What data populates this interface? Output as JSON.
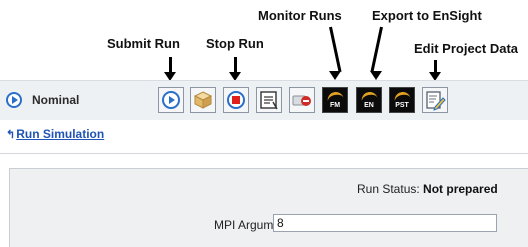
{
  "annotations": {
    "submit_run": "Submit Run",
    "stop_run": "Stop Run",
    "monitor_runs": "Monitor Runs",
    "export_to_ensight": "Export to EnSight",
    "edit_project_data": "Edit Project Data"
  },
  "header": {
    "title": "Nominal"
  },
  "toolbar": {
    "buttons": [
      {
        "icon": "play-circle-icon"
      },
      {
        "icon": "package-box-icon"
      },
      {
        "icon": "stop-icon"
      },
      {
        "icon": "report-icon"
      },
      {
        "icon": "cancel-job-icon"
      },
      {
        "icon": "fm-icon",
        "label": "FM"
      },
      {
        "icon": "en-icon",
        "label": "EN"
      },
      {
        "icon": "pst-icon",
        "label": "PST"
      },
      {
        "icon": "edit-document-icon"
      }
    ]
  },
  "nav": {
    "back_link": "Run Simulation"
  },
  "status": {
    "label": "Run Status:",
    "value": "Not prepared"
  },
  "mpi": {
    "label": "MPI Arguments",
    "value": "8"
  },
  "colors": {
    "accent_blue": "#2a6fc9",
    "link_blue": "#1f54b5",
    "stop_red": "#e0201b",
    "toolbar_bg": "#eef1f4"
  }
}
